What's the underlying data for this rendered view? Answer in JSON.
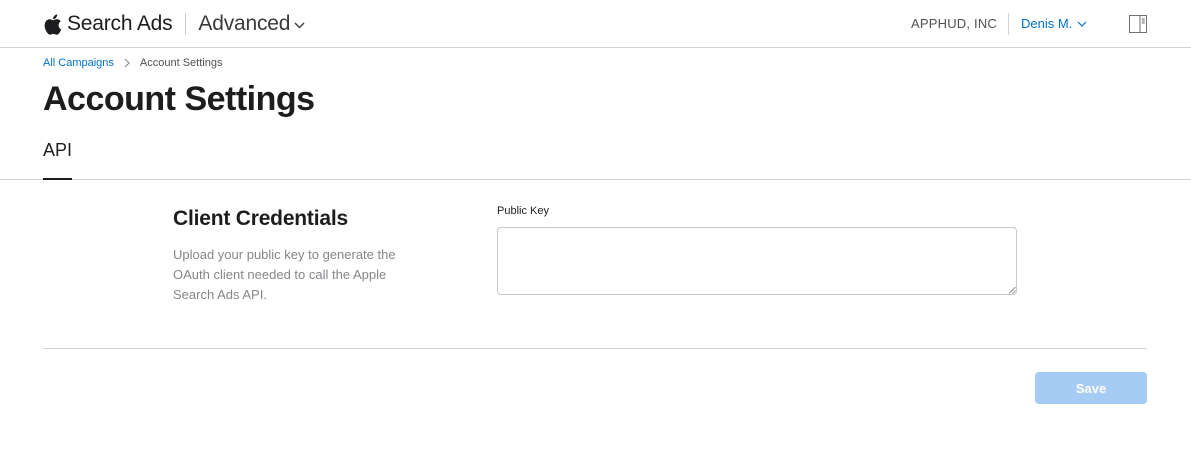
{
  "header": {
    "brand_name": "Search Ads",
    "mode_label": "Advanced",
    "org_name": "APPHUD, INC",
    "user_name": "Denis M."
  },
  "breadcrumb": {
    "parent": "All Campaigns",
    "current": "Account Settings"
  },
  "page": {
    "title": "Account Settings"
  },
  "tabs": [
    {
      "label": "API",
      "active": true
    }
  ],
  "client_credentials": {
    "title": "Client Credentials",
    "description": "Upload your public key to generate the OAuth client needed to call the Apple Search Ads API.",
    "public_key_label": "Public Key",
    "public_key_value": ""
  },
  "footer": {
    "save_label": "Save",
    "save_enabled": false
  },
  "colors": {
    "link": "#0070c9",
    "save_disabled": "#a6cbf5",
    "divider": "#d2d2d7"
  },
  "icons": [
    "apple-logo-icon",
    "chevron-down-icon",
    "panel-icon",
    "chevron-right-icon",
    "resize-handle-icon"
  ]
}
